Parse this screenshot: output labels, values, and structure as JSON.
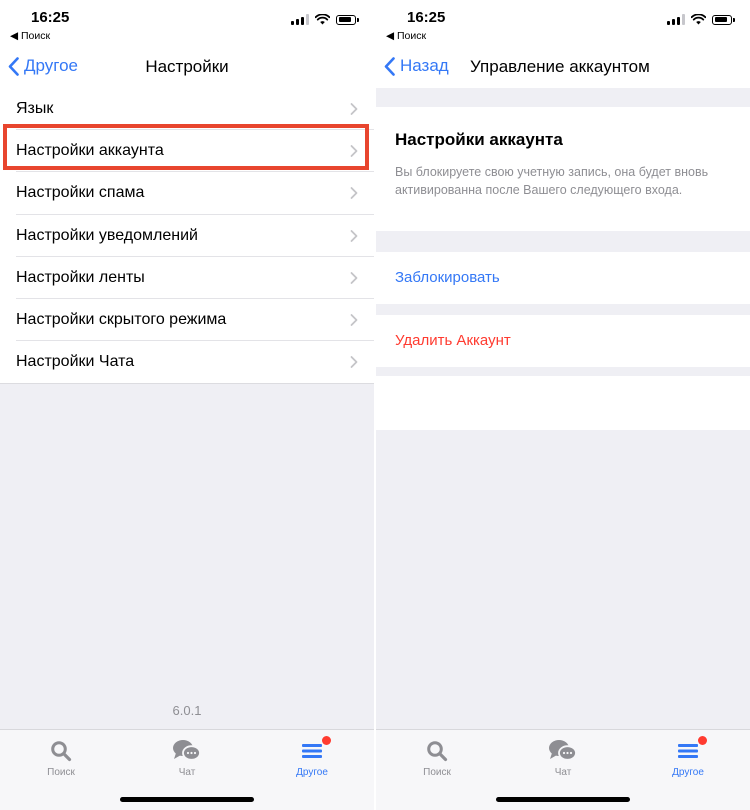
{
  "status": {
    "time": "16:25",
    "back_app": "◀ Поиск"
  },
  "left": {
    "nav": {
      "back_label": "Другое",
      "title": "Настройки"
    },
    "settings_items": [
      {
        "label": "Язык"
      },
      {
        "label": "Настройки аккаунта"
      },
      {
        "label": "Настройки спама"
      },
      {
        "label": "Настройки уведомлений"
      },
      {
        "label": "Настройки ленты"
      },
      {
        "label": "Настройки скрытого режима"
      },
      {
        "label": "Настройки Чата"
      }
    ],
    "version": "6.0.1"
  },
  "right": {
    "nav": {
      "back_label": "Назад",
      "title": "Управление аккаунтом"
    },
    "section": {
      "title": "Настройки аккаунта",
      "description": "Вы блокируете свою учетную запись, она будет вновь активированна после Вашего следующего входа."
    },
    "block_label": "Заблокировать",
    "delete_label": "Удалить Аккаунт"
  },
  "tabbar": [
    {
      "label": "Поиск",
      "icon": "search-icon"
    },
    {
      "label": "Чат",
      "icon": "chat-bubbles-icon"
    },
    {
      "label": "Другое",
      "icon": "menu-lines-icon",
      "active": true,
      "badge": true
    }
  ],
  "colors": {
    "accent": "#3478f6",
    "danger": "#ff3b30",
    "highlight": "#e8452e",
    "badge": "#ff3b30"
  }
}
